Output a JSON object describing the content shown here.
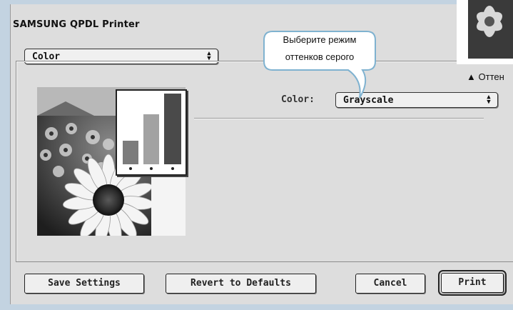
{
  "dialog": {
    "title": "SAMSUNG QPDL Printer",
    "panel_select": {
      "value": "Color",
      "arrow": "up-down-arrows-icon"
    },
    "color": {
      "label": "Color:",
      "value": "Grayscale",
      "arrow": "up-down-arrows-icon"
    },
    "preview": {
      "image": "sunflower-preview",
      "chart_icon": "bar-chart-icon"
    },
    "buttons": {
      "save": "Save Settings",
      "revert": "Revert to Defaults",
      "cancel": "Cancel",
      "print": "Print"
    }
  },
  "annotation": {
    "callout_line1": "Выберите режим",
    "callout_line2": "оттенков серого",
    "caption_marker": "▲",
    "caption_text": "Оттен"
  },
  "colors": {
    "page_frame": "#c3d3e1",
    "dialog_bg": "#dddddd",
    "callout_fill": "#ffffff",
    "callout_stroke": "#7fb2d0"
  }
}
